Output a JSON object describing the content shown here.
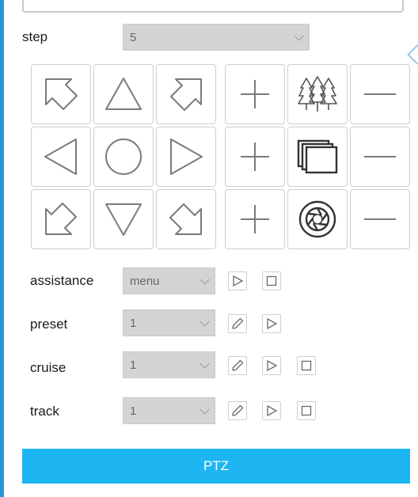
{
  "step": {
    "label": "step",
    "value": "5"
  },
  "assistance": {
    "label": "assistance",
    "value": "menu"
  },
  "preset": {
    "label": "preset",
    "value": "1"
  },
  "cruise": {
    "label": "cruise",
    "value": "1"
  },
  "track": {
    "label": "track",
    "value": "1"
  },
  "ptz": {
    "label": "PTZ"
  },
  "colors": {
    "accent": "#1eb6f2",
    "side_border": "#2b95d8",
    "icon_stroke": "#7a7a7a"
  }
}
